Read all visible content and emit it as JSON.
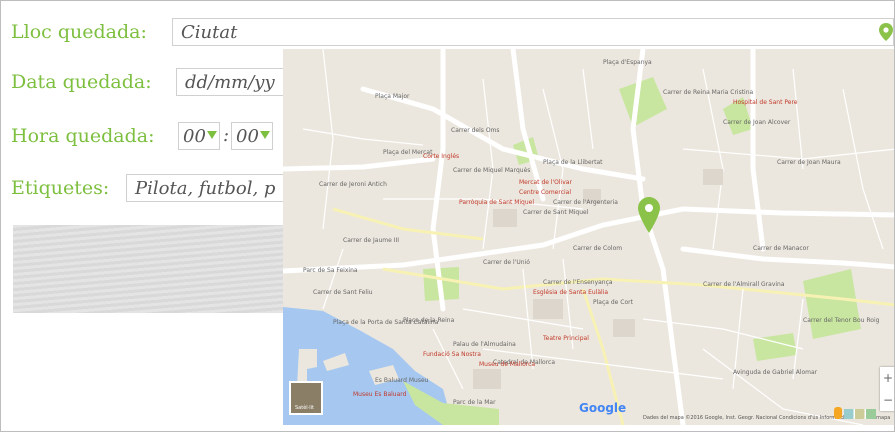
{
  "form": {
    "place_label": "Lloc quedada:",
    "place_value": "Ciutat",
    "date_label": "Data quedada:",
    "date_placeholder": "dd/mm/yy",
    "time_label": "Hora quedada:",
    "hour_value": "00",
    "minute_value": "00",
    "time_separator": ":",
    "tags_label": "Etiquetes:",
    "tags_value": "Pilota, futbol, p"
  },
  "map": {
    "brand": "Google",
    "thumbnail_label": "Satèl·lit",
    "attribution": "Dades del mapa ©2016 Google, Inst. Geogr. Nacional  Condicions d'ús  Informa d'un error del mapa",
    "zoom_in": "+",
    "zoom_out": "−",
    "street_labels": [
      "Plaça Major",
      "Carrer dels Oms",
      "Carrer de Sant Miquel",
      "Plaça d'Espanya",
      "Carrer de Jaume III",
      "Carrer de Sant Feliu",
      "Plaça de la Reina",
      "Carrer de Jeroni Antich",
      "Carrer de Miquel Marquès",
      "Carrer de Manacor",
      "Carrer de Joan Maura",
      "Carrer de Reina Maria Cristina",
      "Carrer del Tenor Bou Roig",
      "Carrer de l'Almirall Gravina",
      "Avinguda de Gabriel Alomar",
      "Carrer de l'Ensenyança",
      "Plaça del Mercat",
      "Palau de l'Almudaina",
      "Catedral de Mallorca",
      "Parc de la Mar",
      "Plaça de la Porta de Santa Catalina",
      "Carrer de l'Unió",
      "Carrer de Colom",
      "Parc de Sa Feixina",
      "Plaça de Cort",
      "Carrer de Joan Alcover",
      "Plaça de la Llibertat",
      "Es Baluard Museu",
      "Carrer de l'Argenteria"
    ],
    "poi_labels": [
      "Mercat de l'Olivar",
      "Centre Comercial",
      "Corte Inglés",
      "Museu de Mallorca",
      "Teatre Principal",
      "Església de Santa Eulàlia",
      "Parròquia de Sant Miquel",
      "Fundació Sa Nostra",
      "Museu Es Baluard",
      "Hospital de Sant Pere"
    ]
  },
  "colors": {
    "label_green": "#7dbf3f",
    "pin_green": "#8bc34a",
    "water": "#a6c8f0",
    "park": "#c8e6a0",
    "road_major": "#ffffff",
    "road_primary": "#f7f2b4"
  }
}
